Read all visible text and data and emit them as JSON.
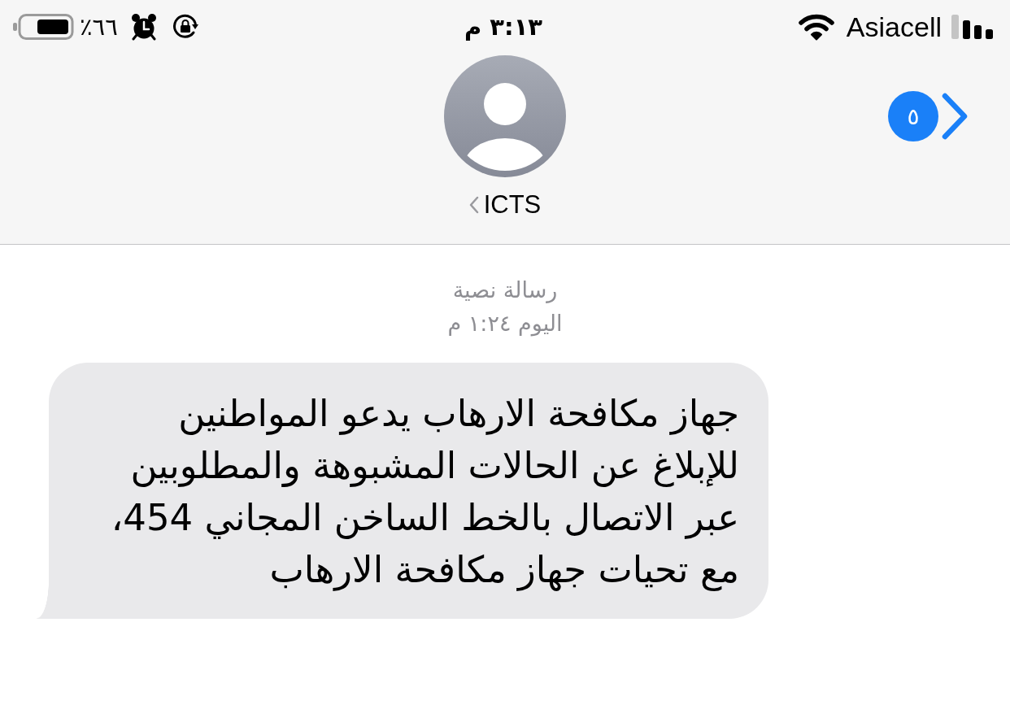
{
  "status_bar": {
    "battery_percent": "٦٦٪",
    "time": "٣:١٣ م",
    "carrier": "Asiacell"
  },
  "navigation": {
    "back_count": "٥",
    "contact_name": "ICTS"
  },
  "conversation": {
    "service_label": "رسالة نصية",
    "timestamp": "اليوم ١:٢٤ م",
    "messages": [
      {
        "text": "جهاز مكافحة الارهاب يدعو المواطنين\nللإبلاغ عن الحالات المشبوهة والمطلوبين\nعبر الاتصال بالخط الساخن المجاني 454،\nمع تحيات جهاز مكافحة الارهاب"
      }
    ]
  }
}
